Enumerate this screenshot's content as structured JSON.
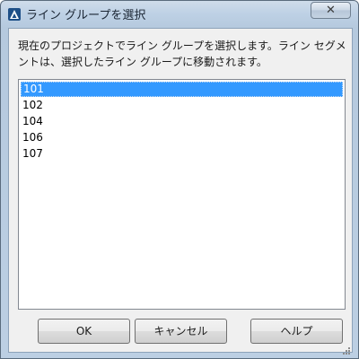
{
  "window": {
    "title": "ライン グループを選択",
    "close_label": "✕"
  },
  "description": "現在のプロジェクトでライン グループを選択します。ライン セグメントは、選択したライン グループに移動されます。",
  "list": {
    "items": [
      "101",
      "102",
      "104",
      "106",
      "107"
    ],
    "selected_index": 0
  },
  "buttons": {
    "ok": "OK",
    "cancel": "キャンセル",
    "help": "ヘルプ"
  },
  "icons": {
    "app": "autocad-logo-icon",
    "close": "close-icon",
    "resize": "resize-grip-icon"
  },
  "colors": {
    "selection": "#3399ff",
    "titlebar": "#bed1e5",
    "accent": "#2d6fb0"
  }
}
